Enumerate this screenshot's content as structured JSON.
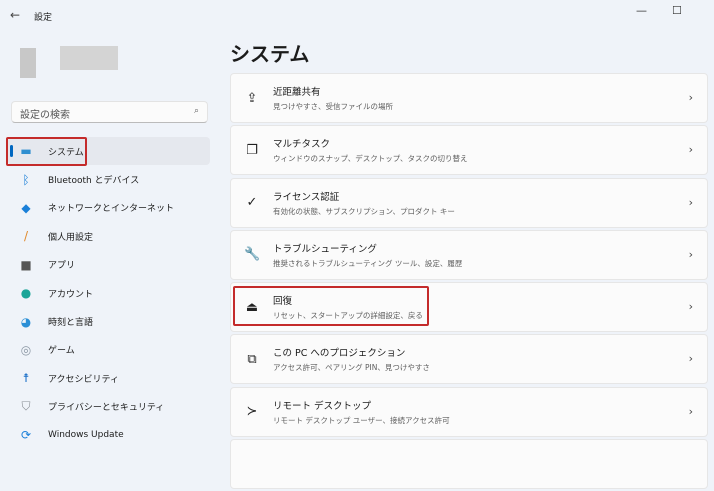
{
  "window": {
    "title": "設定",
    "back_icon": "←",
    "minimize": "—",
    "maximize": "☐"
  },
  "search": {
    "placeholder": "設定の検索",
    "icon": "⌕"
  },
  "nav": [
    {
      "label": "システム",
      "icon": "▬",
      "color": "#2f8fd0"
    },
    {
      "label": "Bluetooth とデバイス",
      "icon": "ᛒ",
      "color": "#1a7fd8"
    },
    {
      "label": "ネットワークとインターネット",
      "icon": "◆",
      "color": "#1a7fd8"
    },
    {
      "label": "個人用設定",
      "icon": "/",
      "color": "#e08a2c"
    },
    {
      "label": "アプリ",
      "icon": "■",
      "color": "#555"
    },
    {
      "label": "アカウント",
      "icon": "●",
      "color": "#1aa598"
    },
    {
      "label": "時刻と言語",
      "icon": "◕",
      "color": "#2b8fd6"
    },
    {
      "label": "ゲーム",
      "icon": "◎",
      "color": "#8a96a3"
    },
    {
      "label": "アクセシビリティ",
      "icon": "☨",
      "color": "#1a6fc8"
    },
    {
      "label": "プライバシーとセキュリティ",
      "icon": "⛉",
      "color": "#8a8f95"
    },
    {
      "label": "Windows Update",
      "icon": "⟳",
      "color": "#1a7fd8"
    }
  ],
  "page_title": "システム",
  "cards": [
    {
      "title": "近距離共有",
      "subtitle": "見つけやすさ、受信ファイルの場所",
      "icon": "⇪"
    },
    {
      "title": "マルチタスク",
      "subtitle": "ウィンドウのスナップ、デスクトップ、タスクの切り替え",
      "icon": "❐"
    },
    {
      "title": "ライセンス認証",
      "subtitle": "有効化の状態、サブスクリプション、プロダクト キー",
      "icon": "✓"
    },
    {
      "title": "トラブルシューティング",
      "subtitle": "推奨されるトラブルシューティング ツール、設定、履歴",
      "icon": "🔧"
    },
    {
      "title": "回復",
      "subtitle": "リセット、スタートアップの詳細設定、戻る",
      "icon": "⏏"
    },
    {
      "title": "この PC へのプロジェクション",
      "subtitle": "アクセス許可、ペアリング PIN、見つけやすさ",
      "icon": "⧉"
    },
    {
      "title": "リモート デスクトップ",
      "subtitle": "リモート デスクトップ ユーザー、接続アクセス許可",
      "icon": "≻"
    }
  ],
  "chevron": "›"
}
